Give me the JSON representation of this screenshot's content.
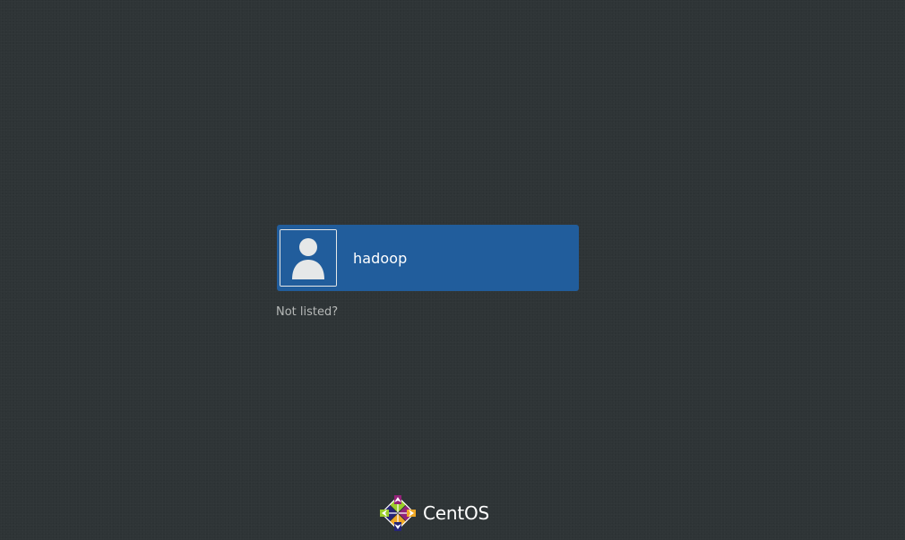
{
  "login": {
    "users": [
      {
        "name": "hadoop",
        "avatar_icon": "user-silhouette-icon"
      }
    ],
    "not_listed_label": "Not listed?"
  },
  "branding": {
    "logo_icon": "centos-logo-icon",
    "logo_text": "CentOS"
  },
  "colors": {
    "background": "#2e3436",
    "selected_user_background": "#215d9c",
    "text_primary": "#ffffff",
    "text_secondary": "#b6b9b8"
  }
}
